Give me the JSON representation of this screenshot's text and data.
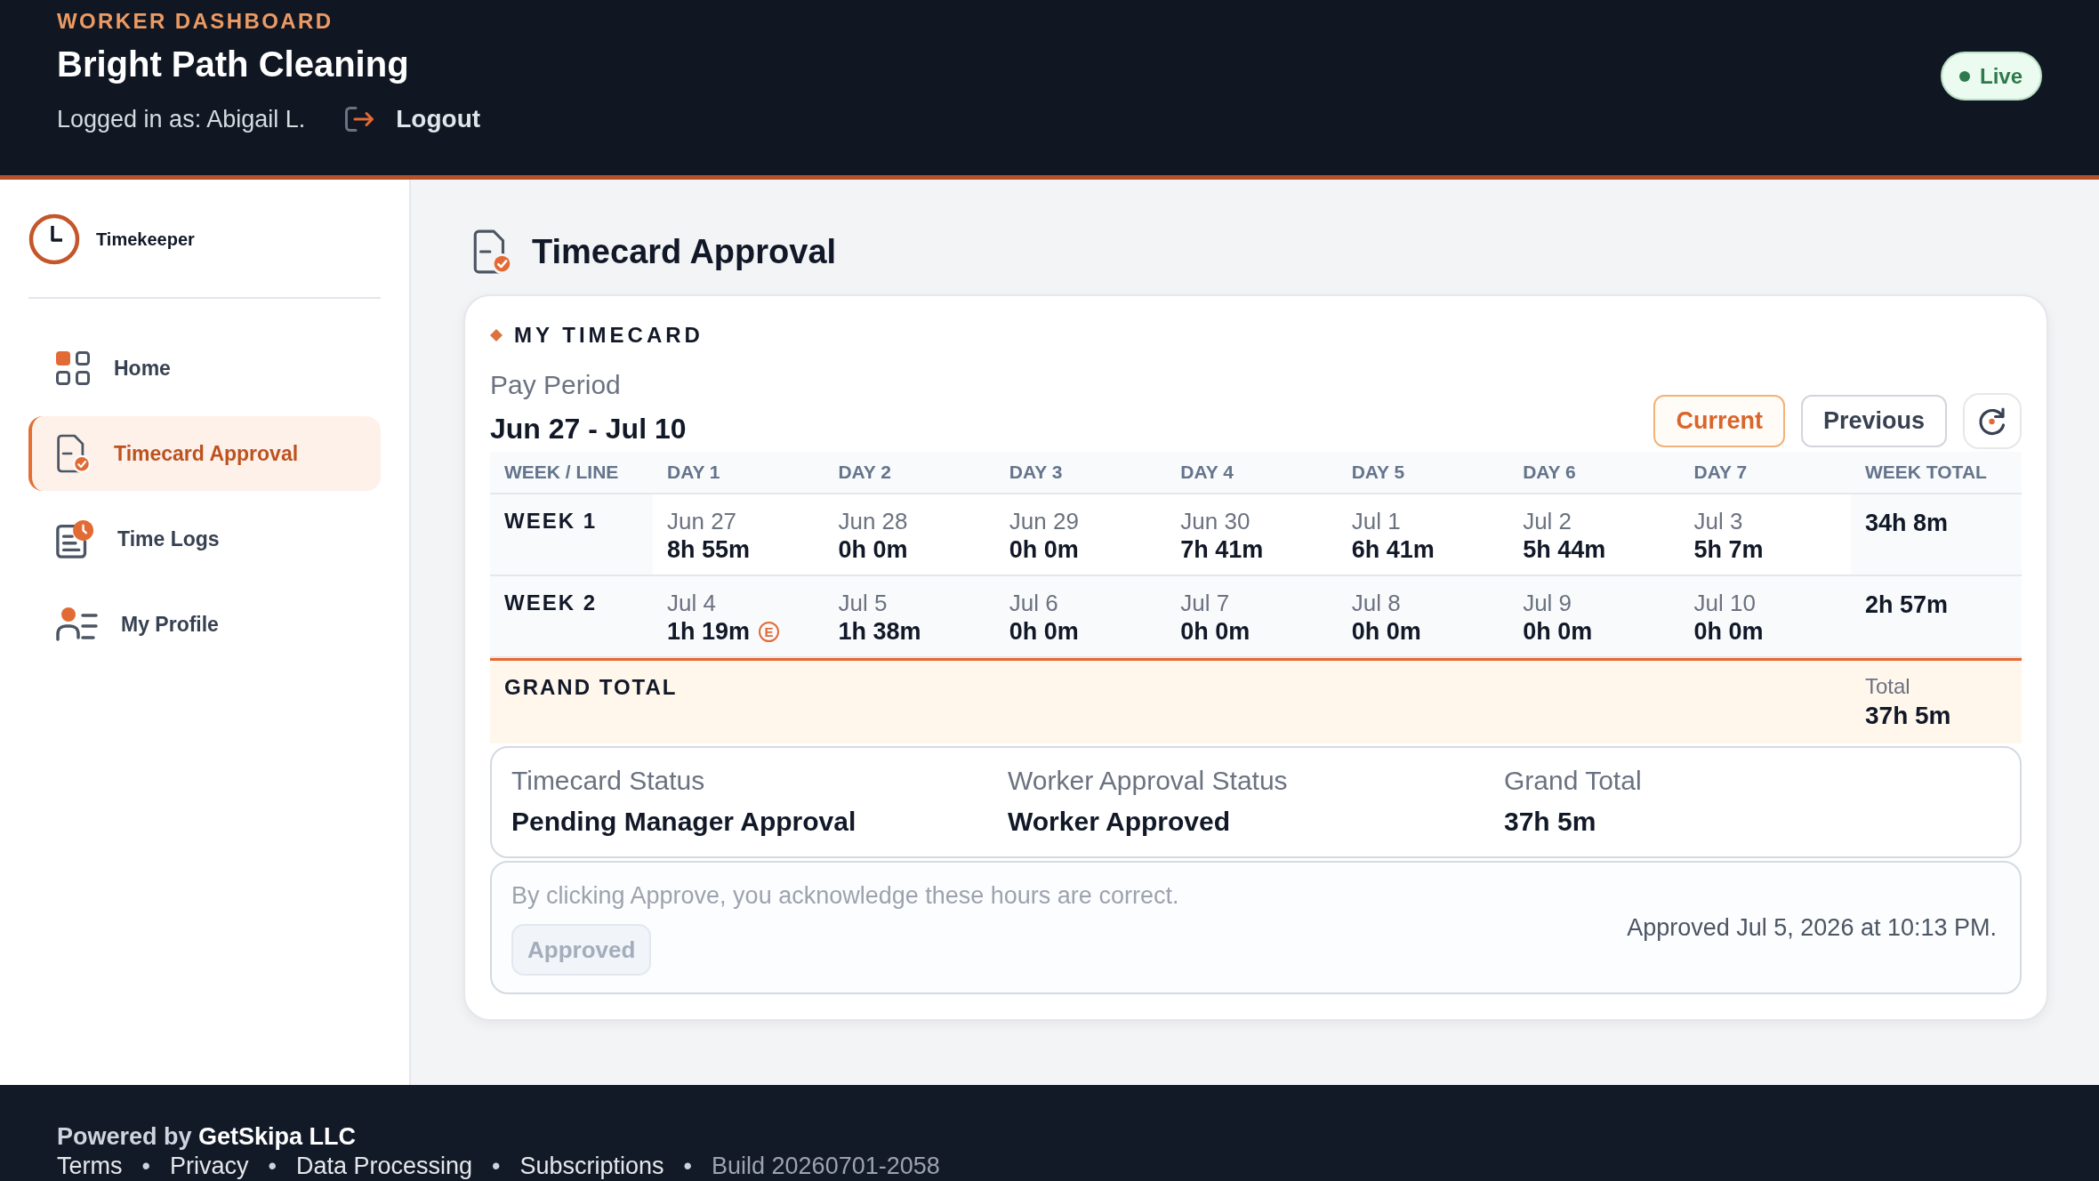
{
  "header": {
    "eyebrow": "WORKER DASHBOARD",
    "title": "Bright Path Cleaning",
    "logged_in": "Logged in as: Abigail L.",
    "logout": "Logout",
    "status_badge": {
      "label": "Live"
    }
  },
  "sidebar": {
    "brand": "Timekeeper",
    "items": [
      {
        "label": "Home",
        "kind": "home",
        "selected": false
      },
      {
        "label": "Timecard Approval",
        "kind": "approval",
        "selected": true
      },
      {
        "label": "Time Logs",
        "kind": "logs",
        "selected": false
      },
      {
        "label": "My Profile",
        "kind": "profile",
        "selected": false
      }
    ]
  },
  "page": {
    "title": "Timecard Approval"
  },
  "timecard": {
    "section_label": "MY TIMECARD",
    "period_label": "Pay Period",
    "period": "Jun 27 - Jul 10",
    "period_buttons": [
      {
        "label": "Current",
        "selected": true
      },
      {
        "label": "Previous",
        "selected": false
      }
    ],
    "table": {
      "columns": [
        "WEEK / LINE",
        "DAY 1",
        "DAY 2",
        "DAY 3",
        "DAY 4",
        "DAY 5",
        "DAY 6",
        "DAY 7",
        "WEEK TOTAL"
      ],
      "rows": [
        {
          "week": "WEEK 1",
          "total": "34h 8m",
          "days": [
            {
              "date": "Jun 27",
              "hours": "8h 55m"
            },
            {
              "date": "Jun 28",
              "hours": "0h 0m"
            },
            {
              "date": "Jun 29",
              "hours": "0h 0m"
            },
            {
              "date": "Jun 30",
              "hours": "7h 41m"
            },
            {
              "date": "Jul 1",
              "hours": "6h 41m"
            },
            {
              "date": "Jul 2",
              "hours": "5h 44m"
            },
            {
              "date": "Jul 3",
              "hours": "5h 7m"
            }
          ]
        },
        {
          "week": "WEEK 2",
          "total": "2h 57m",
          "days": [
            {
              "date": "Jul 4",
              "hours": "1h 19m",
              "badge": "E"
            },
            {
              "date": "Jul 5",
              "hours": "1h 38m"
            },
            {
              "date": "Jul 6",
              "hours": "0h 0m"
            },
            {
              "date": "Jul 7",
              "hours": "0h 0m"
            },
            {
              "date": "Jul 8",
              "hours": "0h 0m"
            },
            {
              "date": "Jul 9",
              "hours": "0h 0m"
            },
            {
              "date": "Jul 10",
              "hours": "0h 0m"
            }
          ]
        }
      ],
      "grand_total": {
        "label": "GRAND TOTAL",
        "total_label": "Total",
        "total": "37h 5m"
      }
    },
    "status": [
      {
        "label": "Timecard Status",
        "value": "Pending Manager Approval"
      },
      {
        "label": "Worker Approval Status",
        "value": "Worker Approved"
      },
      {
        "label": "Grand Total",
        "value": "37h 5m"
      }
    ],
    "approval": {
      "notice": "By clicking Approve, you acknowledge these hours are correct.",
      "button": {
        "label": "Approved",
        "disabled": true
      },
      "approved_at": "Approved Jul 5, 2026 at 10:13 PM."
    }
  },
  "footer": {
    "credit": "Powered by **GetSkipa LLC**",
    "items": [
      {
        "kind": "link",
        "label": "Terms"
      },
      {
        "kind": "separator",
        "label": "•"
      },
      {
        "kind": "link",
        "label": "Privacy"
      },
      {
        "kind": "separator",
        "label": "•"
      },
      {
        "kind": "link",
        "label": "Data Processing"
      },
      {
        "kind": "separator",
        "label": "•"
      },
      {
        "kind": "link",
        "label": "Subscriptions"
      },
      {
        "kind": "separator",
        "label": "•"
      },
      {
        "kind": "text",
        "label": "Build 20260701-2058"
      }
    ]
  }
}
